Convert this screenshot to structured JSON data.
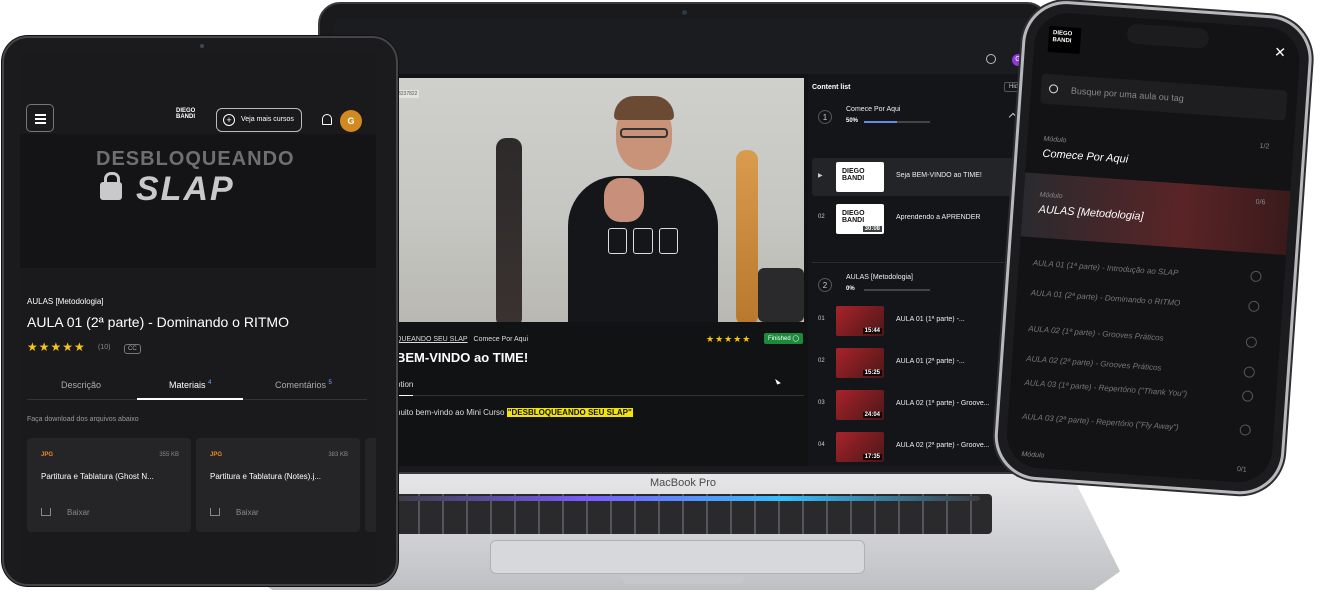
{
  "laptop": {
    "model_label": "MacBook Pro",
    "topbar": {
      "avatar_letter": "G"
    },
    "video": {
      "tag": "3237822"
    },
    "breadcrumb": {
      "course": "QUEANDO SEU SLAP",
      "module": "Comece Por Aqui"
    },
    "rating_stars": "★★★★★",
    "status_badge": "Finished ◯",
    "lesson_title": "BEM-VINDO ao TIME!",
    "tab_label": "ption",
    "description": {
      "prefix": "nuito bem-vindo ao Mini Curso ",
      "highlight": "\"DESBLOQUEANDO SEU SLAP\""
    },
    "content_list": {
      "title": "Content list",
      "hide_label": "Hide ›",
      "sections": [
        {
          "number": "1",
          "name": "Comece Por Aqui",
          "progress": "50%",
          "progress_value": 50,
          "items": [
            {
              "number": "▶",
              "name": "Seja BEM-VINDO ao TIME!",
              "duration": "",
              "thumb_logo": "DIEGO BANDI",
              "check": "✓"
            },
            {
              "number": "02",
              "name": "Aprendendo a APRENDER",
              "duration": "30:08",
              "thumb_logo": "DIEGO BANDI",
              "check": "✓"
            }
          ]
        },
        {
          "number": "2",
          "name": "AULAS [Metodologia]",
          "progress": "0%",
          "progress_value": 0,
          "items": [
            {
              "number": "01",
              "name": "AULA 01 (1ª parte) -...",
              "duration": "15:44",
              "check": "✓"
            },
            {
              "number": "02",
              "name": "AULA 01 (2ª parte) -...",
              "duration": "15:25",
              "check": "✓"
            },
            {
              "number": "03",
              "name": "AULA 02 (1ª parte) - Groove...",
              "duration": "24:04",
              "check": "✓"
            },
            {
              "number": "04",
              "name": "AULA 02 (2ª parte) - Groove...",
              "duration": "17:35",
              "check": ""
            }
          ]
        }
      ]
    }
  },
  "tablet": {
    "logo": "DIEGO BANDI",
    "courses_button": "Veja mais cursos",
    "avatar_letter": "G",
    "hero": {
      "line1": "DESBLOQUEANDO",
      "line2": "SLAP"
    },
    "category": "AULAS [Metodologia]",
    "title": "AULA 01 (2ª parte) - Dominando o RITMO",
    "stars": "★★★★★",
    "rating_count": "(10)",
    "cc_label": "CC",
    "tabs": [
      {
        "label": "Descrição",
        "count": ""
      },
      {
        "label": "Materiais",
        "count": "4"
      },
      {
        "label": "Comentários",
        "count": "5"
      }
    ],
    "download_hint": "Faça download dos arquivos abaixo",
    "files": [
      {
        "type": "JPG",
        "size": "355 KB",
        "name": "Partitura e Tablatura (Ghost N...",
        "download": "Baixar"
      },
      {
        "type": "JPG",
        "size": "383 KB",
        "name": "Partitura e Tablatura (Notes).j...",
        "download": "Baixar"
      }
    ]
  },
  "phone": {
    "logo": "DIEGO BANDI",
    "close": "✕",
    "search_placeholder": "Busque por uma aula ou tag",
    "modules": [
      {
        "label": "Módulo",
        "name": "Comece Por Aqui",
        "count": "1/2"
      },
      {
        "label": "Módulo",
        "name": "AULAS [Metodologia]",
        "count": "0/6"
      },
      {
        "label": "Módulo",
        "name": "",
        "count": "0/1"
      }
    ],
    "lessons": [
      "AULA 01 (1ª parte) - Introdução ao SLAP",
      "AULA 01 (2ª parte) - Dominando o RITMO",
      "AULA 02 (1ª parte) - Grooves Práticos",
      "AULA 02 (2ª parte) - Grooves Práticos",
      "AULA 03 (1ª parte) - Repertório (\"Thank You\")",
      "AULA 03 (2ª parte) - Repertório (\"Fly Away\")"
    ]
  }
}
